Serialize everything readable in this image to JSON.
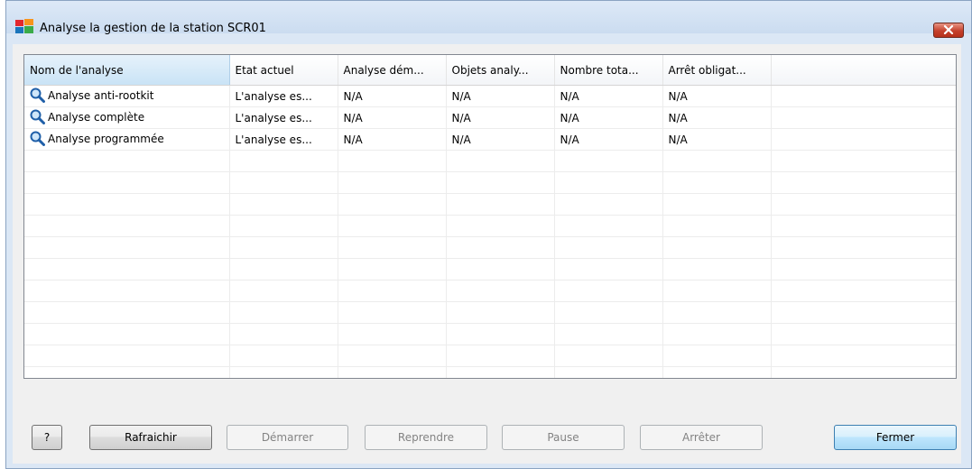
{
  "window": {
    "title": "Analyse la gestion de la station SCR01",
    "app_icon": "avg-logo-icon",
    "close_icon": "close-icon"
  },
  "table": {
    "columns": [
      "Nom de l'analyse",
      "Etat actuel",
      "Analyse dém...",
      "Objets analy...",
      "Nombre tota...",
      "Arrêt obligat..."
    ],
    "sorted_column": "Nom de l'analyse",
    "row_icon": "magnifier-icon",
    "rows": [
      [
        "Analyse anti-rootkit",
        "L'analyse es...",
        "N/A",
        "N/A",
        "N/A",
        "N/A"
      ],
      [
        "Analyse complète",
        "L'analyse es...",
        "N/A",
        "N/A",
        "N/A",
        "N/A"
      ],
      [
        "Analyse programmée",
        "L'analyse es...",
        "N/A",
        "N/A",
        "N/A",
        "N/A"
      ]
    ]
  },
  "buttons": {
    "help": "?",
    "refresh": "Rafraichir",
    "start": "Démarrer",
    "resume": "Reprendre",
    "pause": "Pause",
    "stop": "Arrêter",
    "close": "Fermer"
  },
  "colors": {
    "header_sorted": "#c9e3f6",
    "close_button": "#c5412c",
    "default_button": "#a7d9f5",
    "disabled_text": "#838383"
  }
}
